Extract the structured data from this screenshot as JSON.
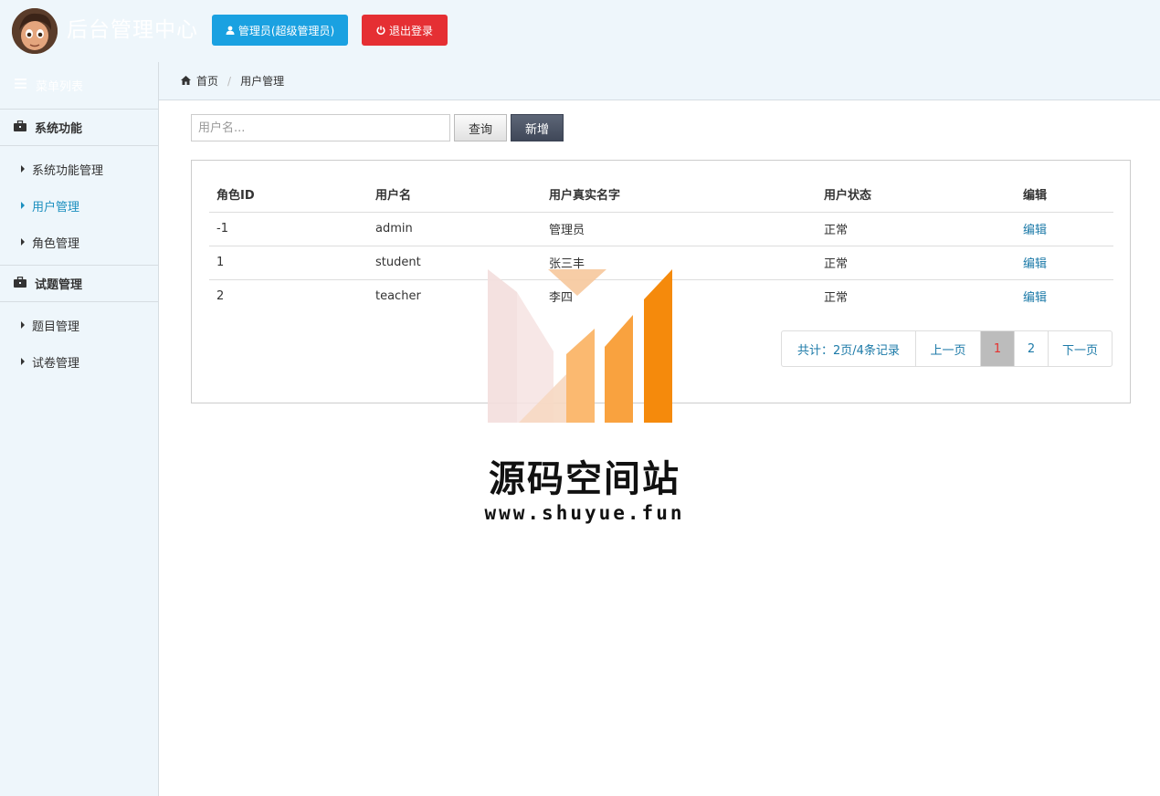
{
  "header": {
    "app_title": "后台管理中心",
    "user_button": "管理员(超级管理员)",
    "logout_button": "退出登录"
  },
  "sidebar": {
    "menu_list_label": "菜单列表",
    "groups": [
      {
        "title": "系统功能",
        "items": [
          {
            "label": "系统功能管理",
            "active": false
          },
          {
            "label": "用户管理",
            "active": true
          },
          {
            "label": "角色管理",
            "active": false
          }
        ]
      },
      {
        "title": "试题管理",
        "items": [
          {
            "label": "题目管理",
            "active": false
          },
          {
            "label": "试卷管理",
            "active": false
          }
        ]
      }
    ]
  },
  "breadcrumb": {
    "home": "首页",
    "current": "用户管理"
  },
  "toolbar": {
    "search_placeholder": "用户名...",
    "query_label": "查询",
    "add_label": "新增"
  },
  "table": {
    "columns": [
      "角色ID",
      "用户名",
      "用户真实名字",
      "用户状态",
      "编辑"
    ],
    "rows": [
      {
        "id": "-1",
        "username": "admin",
        "realname": "管理员",
        "status": "正常",
        "edit": "编辑"
      },
      {
        "id": "1",
        "username": "student",
        "realname": "张三丰",
        "status": "正常",
        "edit": "编辑"
      },
      {
        "id": "2",
        "username": "teacher",
        "realname": "李四",
        "status": "正常",
        "edit": "编辑"
      }
    ]
  },
  "pager": {
    "total": "共计：2页/4条记录",
    "prev": "上一页",
    "page1": "1",
    "page2": "2",
    "next": "下一页"
  },
  "watermark": {
    "title": "源码空间站",
    "url": "www.shuyue.fun"
  },
  "colors": {
    "header_bg": "#eef6fb",
    "user_button": "#1aa1e1",
    "logout_button": "#e52f33",
    "link": "#1c7aa8",
    "active_page": "#e5312f"
  }
}
